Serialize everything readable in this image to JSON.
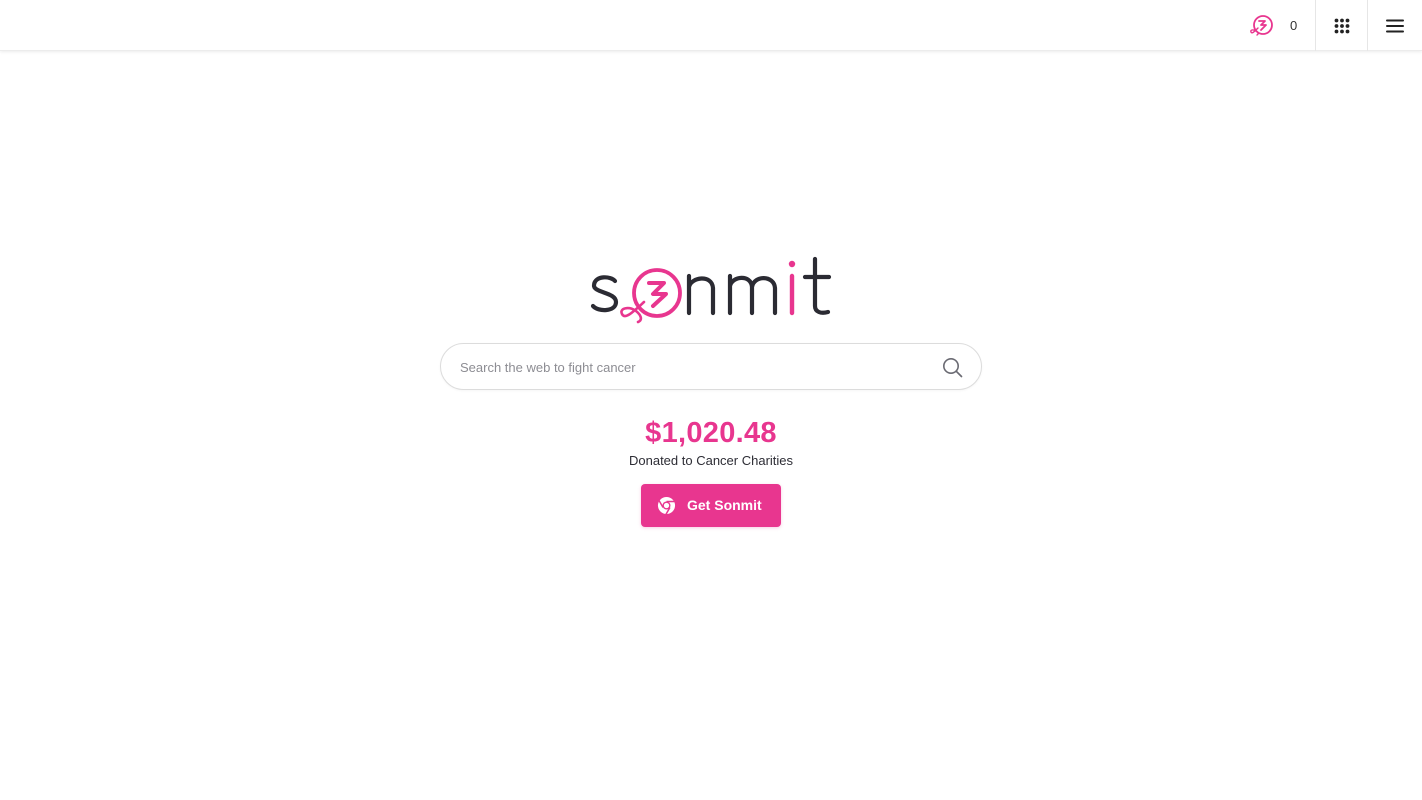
{
  "header": {
    "searches_count": "0",
    "icons": {
      "counter": "ribbon-coin-icon",
      "apps": "apps-grid-icon",
      "menu": "hamburger-menu-icon"
    }
  },
  "logo": {
    "text": "sonmit",
    "dark_color": "#2b2b33",
    "accent_color": "#e8368f"
  },
  "search": {
    "placeholder": "Search the web to fight cancer",
    "value": "",
    "icon": "search-icon"
  },
  "donation": {
    "amount": "$1,020.48",
    "caption": "Donated to Cancer Charities"
  },
  "cta": {
    "label": "Get Sonmit",
    "icon": "chrome-icon",
    "color": "#e8368f"
  }
}
